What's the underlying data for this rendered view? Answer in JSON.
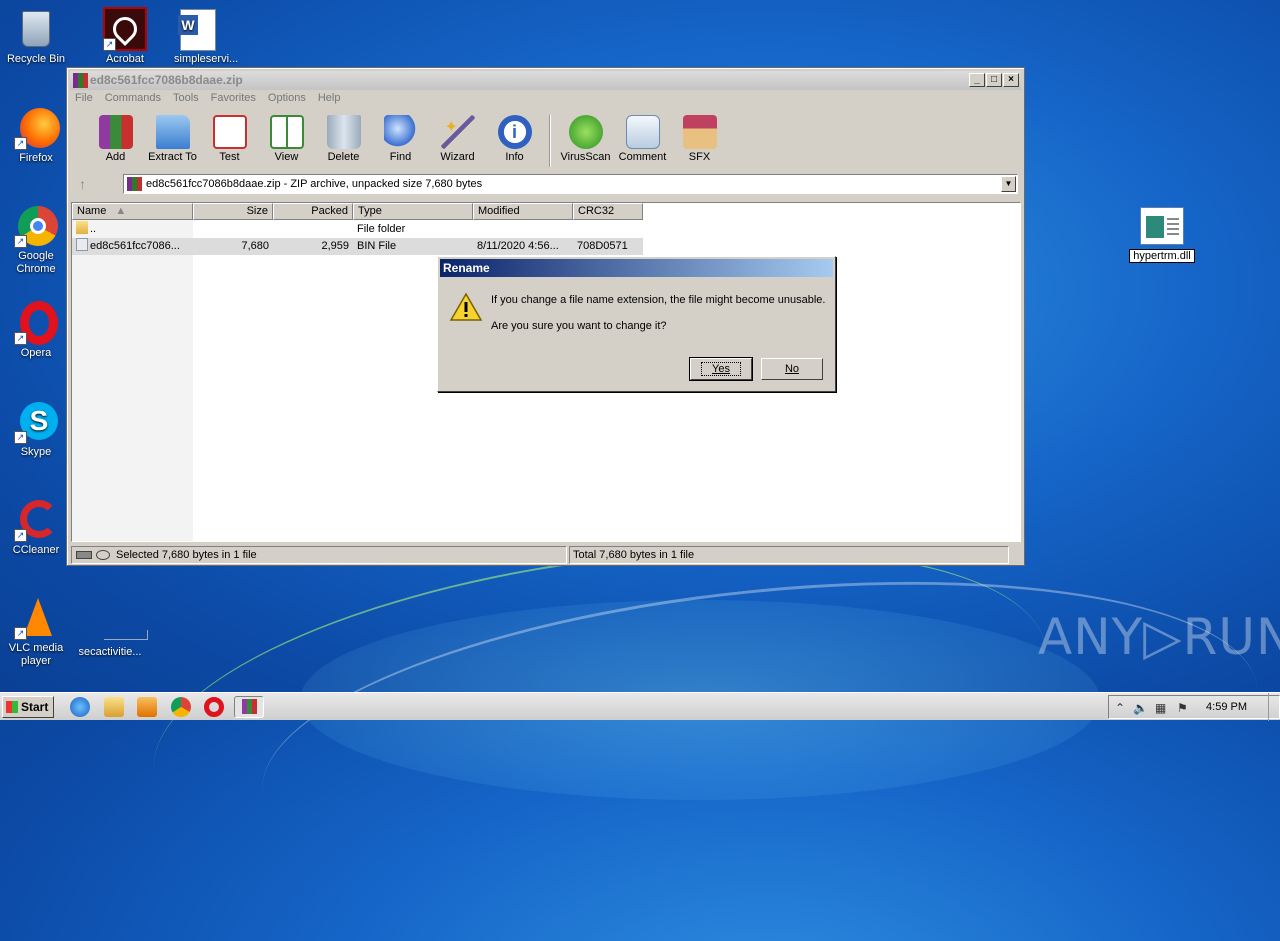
{
  "desktop": {
    "icons": [
      {
        "label": "Recycle Bin"
      },
      {
        "label": "Acrobat"
      },
      {
        "label": "simpleservi..."
      },
      {
        "label": "Firefox"
      },
      {
        "label": "Google Chrome"
      },
      {
        "label": "Opera"
      },
      {
        "label": "Skype"
      },
      {
        "label": "CCleaner"
      },
      {
        "label": "VLC media player"
      },
      {
        "label": "secactivitie..."
      }
    ],
    "renaming_file": "hypertrm.dll",
    "watermark": "ANY▷RUN"
  },
  "window": {
    "title": "ed8c561fcc7086b8daae.zip",
    "controls": {
      "minimize": "_",
      "maximize": "□",
      "close": "×"
    },
    "menu": [
      "File",
      "Commands",
      "Tools",
      "Favorites",
      "Options",
      "Help"
    ],
    "toolbar": [
      {
        "label": "Add",
        "color": "#8e3aa0"
      },
      {
        "label": "Extract To",
        "color": "#4a90d9"
      },
      {
        "label": "Test",
        "color": "#d04040"
      },
      {
        "label": "View",
        "color": "#3a8a3a"
      },
      {
        "label": "Delete",
        "color": "#8a9aa8"
      },
      {
        "label": "Find",
        "color": "#3a6fd0"
      },
      {
        "label": "Wizard",
        "color": "#c8a030"
      },
      {
        "label": "Info",
        "color": "#3060c0"
      },
      {
        "label": "VirusScan",
        "color": "#3aa030"
      },
      {
        "label": "Comment",
        "color": "#6a8ab0"
      },
      {
        "label": "SFX",
        "color": "#c04060"
      }
    ],
    "address": "ed8c561fcc7086b8daae.zip - ZIP archive, unpacked size 7,680 bytes",
    "columns": [
      "Name",
      "Size",
      "Packed",
      "Type",
      "Modified",
      "CRC32"
    ],
    "rows": [
      {
        "name": "..",
        "size": "",
        "packed": "",
        "type": "File folder",
        "modified": "",
        "crc": ""
      },
      {
        "name": "ed8c561fcc7086...",
        "size": "7,680",
        "packed": "2,959",
        "type": "BIN File",
        "modified": "8/11/2020 4:56...",
        "crc": "708D0571"
      }
    ],
    "status_left": "Selected 7,680 bytes in 1 file",
    "status_right": "Total 7,680 bytes in 1 file"
  },
  "dialog": {
    "title": "Rename",
    "message1": "If you change a file name extension, the file might become unusable.",
    "message2": "Are you sure you want to change it?",
    "yes": "Yes",
    "no": "No"
  },
  "taskbar": {
    "start": "Start",
    "clock": "4:59 PM"
  }
}
